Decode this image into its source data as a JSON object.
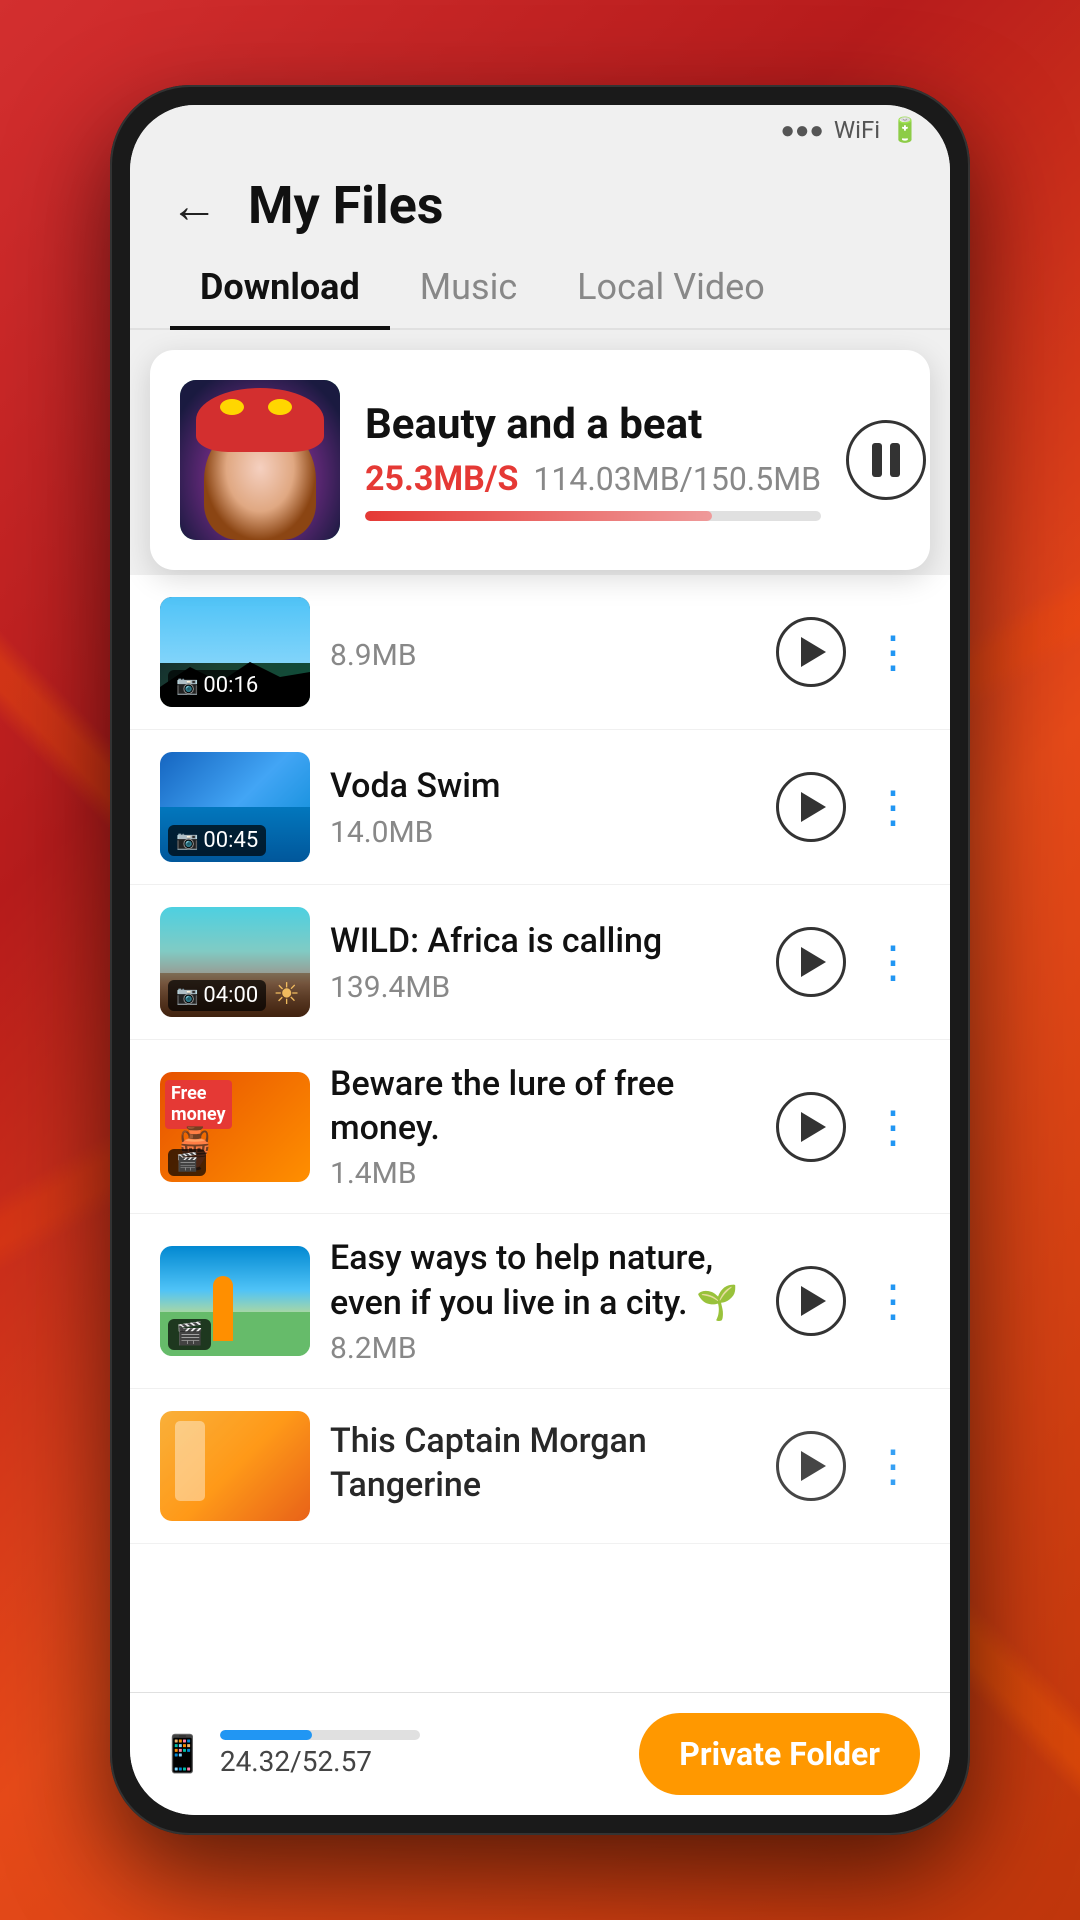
{
  "app": {
    "title": "My Files",
    "back_label": "←"
  },
  "tabs": [
    {
      "id": "download",
      "label": "Download",
      "active": true
    },
    {
      "id": "music",
      "label": "Music",
      "active": false
    },
    {
      "id": "local-video",
      "label": "Local Video",
      "active": false
    }
  ],
  "active_download": {
    "title": "Beauty and a beat",
    "speed": "25.3MB/S",
    "progress_text": "114.03MB/150.5MB",
    "progress_percent": 76
  },
  "files": [
    {
      "id": 1,
      "name": "",
      "size": "8.9MB",
      "duration": "00:16",
      "thumb_type": "dark-forest"
    },
    {
      "id": 2,
      "name": "Voda Swim",
      "size": "14.0MB",
      "duration": "00:45",
      "thumb_type": "ocean"
    },
    {
      "id": 3,
      "name": "WILD: Africa is calling",
      "size": "139.4MB",
      "duration": "04:00",
      "thumb_type": "africa"
    },
    {
      "id": 4,
      "name": "Beware the lure of free money.",
      "size": "1.4MB",
      "duration": "",
      "thumb_type": "free-money"
    },
    {
      "id": 5,
      "name": "Easy ways to help nature, even if you live in a city. 🌱",
      "size": "8.2MB",
      "duration": "",
      "thumb_type": "nature"
    },
    {
      "id": 6,
      "name": "This Captain Morgan Tangerine",
      "size": "",
      "duration": "",
      "thumb_type": "captain"
    }
  ],
  "bottom_bar": {
    "storage_used": "24.32/52.57",
    "storage_percent": 46,
    "private_folder_label": "Private Folder"
  },
  "icons": {
    "play": "▶",
    "pause": "⏸",
    "more": "⋮",
    "phone": "📱",
    "camera": "📷"
  }
}
